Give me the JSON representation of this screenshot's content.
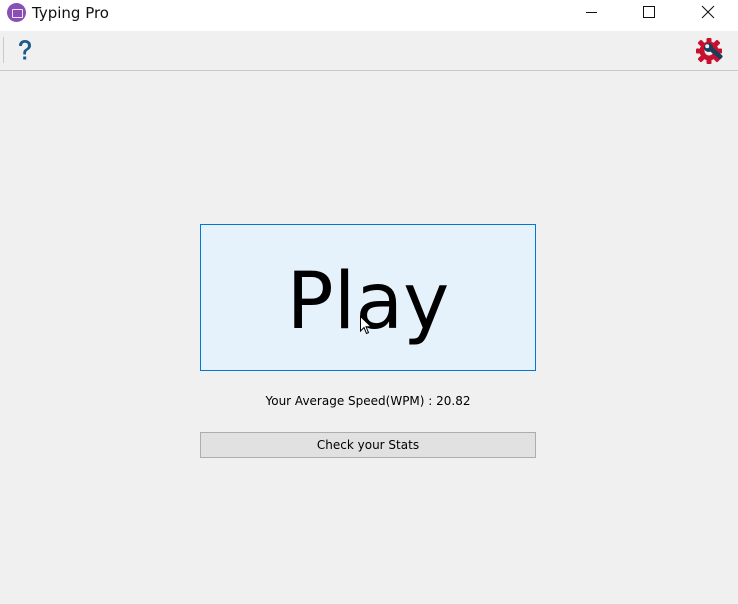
{
  "window": {
    "title": "Typing Pro",
    "controls": [
      "minimize",
      "maximize",
      "close"
    ]
  },
  "toolbar": {
    "help_icon": "help-question-icon",
    "settings_icon": "settings-gear-wrench-icon"
  },
  "main": {
    "play_label": "Play",
    "speed_label": "Your Average Speed(WPM) : 20.82",
    "stats_button_label": "Check your Stats"
  },
  "colors": {
    "play_bg": "#e5f1fb",
    "play_border": "#0078d7",
    "help_icon": "#1a5a8a",
    "settings_icon": "#c8102e",
    "app_icon": "#8a4fb3"
  }
}
